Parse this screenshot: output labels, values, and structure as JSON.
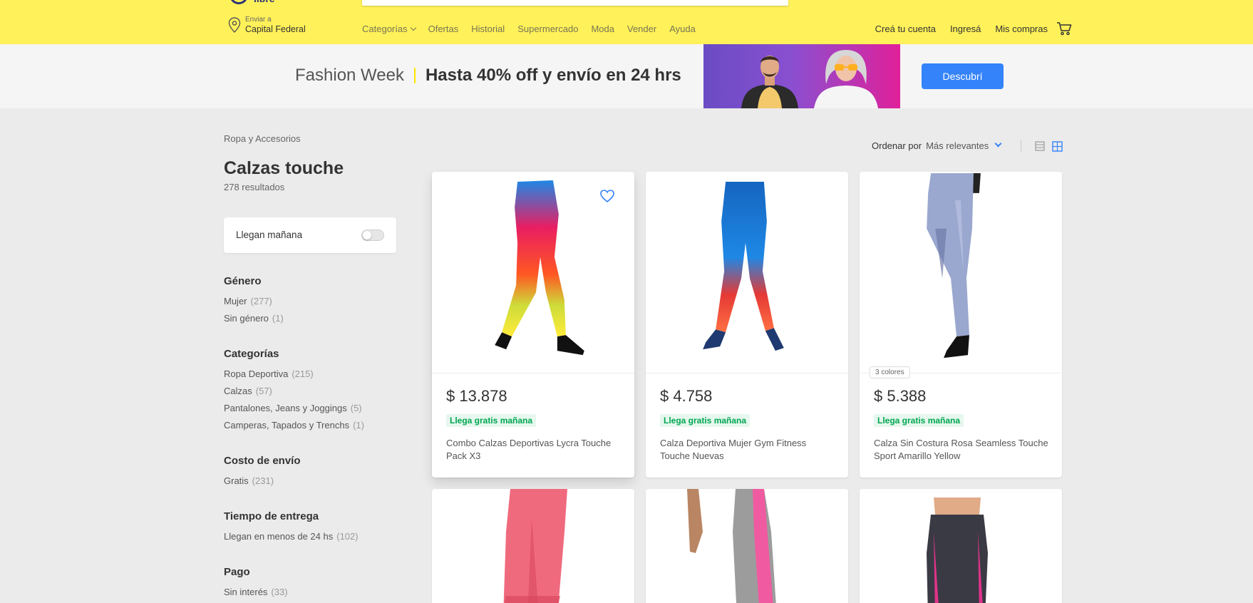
{
  "header": {
    "logo_text": "libre",
    "location_small": "Enviar a",
    "location_big": "Capital Federal",
    "nav": [
      "Categorías",
      "Ofertas",
      "Historial",
      "Supermercado",
      "Moda",
      "Vender",
      "Ayuda"
    ],
    "user_nav": [
      "Creá tu cuenta",
      "Ingresá",
      "Mis compras"
    ],
    "accent_color": "#fff159"
  },
  "promo": {
    "light": "Fashion Week",
    "bold": "Hasta 40% off y envío en 24 hrs",
    "button": "Descubrí",
    "button_color": "#3483fa"
  },
  "page": {
    "breadcrumb": "Ropa y Accesorios",
    "title": "Calzas touche",
    "results": "278 resultados"
  },
  "sort": {
    "label": "Ordenar por",
    "value": "Más relevantes"
  },
  "toggle": {
    "label": "Llegan mañana"
  },
  "filters": [
    {
      "title": "Género",
      "items": [
        {
          "label": "Mujer",
          "count": "(277)"
        },
        {
          "label": "Sin género",
          "count": "(1)"
        }
      ]
    },
    {
      "title": "Categorías",
      "items": [
        {
          "label": "Ropa Deportiva",
          "count": "(215)"
        },
        {
          "label": "Calzas",
          "count": "(57)"
        },
        {
          "label": "Pantalones, Jeans y Joggings",
          "count": "(5)"
        },
        {
          "label": "Camperas, Tapados y Trenchs",
          "count": "(1)"
        }
      ]
    },
    {
      "title": "Costo de envío",
      "items": [
        {
          "label": "Gratis",
          "count": "(231)"
        }
      ]
    },
    {
      "title": "Tiempo de entrega",
      "items": [
        {
          "label": "Llegan en menos de 24 hs",
          "count": "(102)"
        }
      ]
    },
    {
      "title": "Pago",
      "items": [
        {
          "label": "Sin interés",
          "count": "(33)"
        }
      ]
    }
  ],
  "products": [
    {
      "price": "$ 13.878",
      "shipping": "Llega gratis mañana",
      "title": "Combo Calzas Deportivas Lycra Touche Pack X3"
    },
    {
      "price": "$ 4.758",
      "shipping": "Llega gratis mañana",
      "title": "Calza Deportiva Mujer Gym Fitness Touche Nuevas"
    },
    {
      "price": "$ 5.388",
      "shipping": "Llega gratis mañana",
      "title": "Calza Sin Costura Rosa Seamless Touche Sport Amarillo Yellow",
      "badge": "3 colores"
    }
  ],
  "shipping_color": "#00a650"
}
